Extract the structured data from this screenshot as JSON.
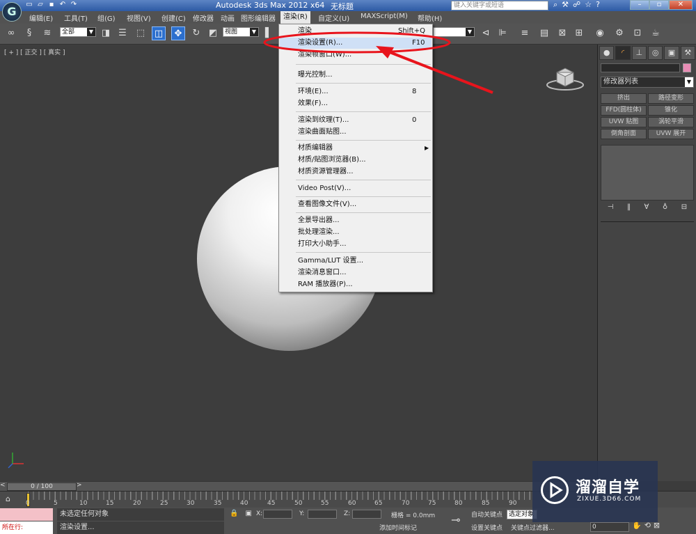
{
  "titlebar": {
    "app_logo": "G",
    "title": "Autodesk 3ds Max  2012 x64",
    "document": "无标题",
    "search_placeholder": "键入关键字或短语",
    "quick_access_icons": [
      "new-file-icon",
      "open-icon",
      "save-icon",
      "undo-icon",
      "redo-icon"
    ],
    "window_controls": [
      "minimize",
      "restore",
      "close"
    ]
  },
  "menubar": {
    "items": [
      "编辑(E)",
      "工具(T)",
      "组(G)",
      "视图(V)",
      "创建(C)",
      "修改器",
      "动画",
      "图形编辑器",
      "渲染(R)",
      "自定义(U)",
      "MAXScript(M)",
      "帮助(H)"
    ],
    "active": "渲染(R)"
  },
  "toolbar": {
    "selection_filter": "全部",
    "reference_coord": "视图"
  },
  "viewport": {
    "label": "[ + ] [ 正交 ] [ 真实 ]"
  },
  "render_menu": {
    "items": [
      {
        "label": "渲染",
        "shortcut": "Shift+Q"
      },
      {
        "label": "渲染设置(R)...",
        "shortcut": "F10"
      },
      {
        "label": "渲染帧窗口(W)...",
        "shortcut": ""
      },
      {
        "label": "曝光控制...",
        "shortcut": ""
      },
      {
        "label": "环境(E)...",
        "shortcut": "8"
      },
      {
        "label": "效果(F)...",
        "shortcut": ""
      },
      {
        "label": "渲染到纹理(T)...",
        "shortcut": "0"
      },
      {
        "label": "渲染曲面贴图...",
        "shortcut": ""
      },
      {
        "label": "材质编辑器",
        "shortcut": ""
      },
      {
        "label": "材质/贴图浏览器(B)...",
        "shortcut": ""
      },
      {
        "label": "材质资源管理器...",
        "shortcut": ""
      },
      {
        "label": "Video Post(V)...",
        "shortcut": ""
      },
      {
        "label": "查看图像文件(V)...",
        "shortcut": ""
      },
      {
        "label": "全景导出器...",
        "shortcut": ""
      },
      {
        "label": "批处理渲染...",
        "shortcut": ""
      },
      {
        "label": "打印大小助手...",
        "shortcut": ""
      },
      {
        "label": "Gamma/LUT 设置...",
        "shortcut": ""
      },
      {
        "label": "渲染消息窗口...",
        "shortcut": ""
      },
      {
        "label": "RAM 播放器(P)...",
        "shortcut": ""
      }
    ],
    "highlighted": "渲染设置(R)..."
  },
  "right_panel": {
    "modifier_list": "修改器列表",
    "modifier_buttons": [
      "挤出",
      "路径变形",
      "FFD(圆柱体)",
      "锥化",
      "UVW 贴图",
      "涡轮平滑",
      "倒角剖面",
      "UVW 展开"
    ],
    "swatch_color": "#e88cb5"
  },
  "timeline": {
    "frame": "0 / 100",
    "tick_labels": [
      "0",
      "5",
      "10",
      "15",
      "20",
      "25",
      "30",
      "35",
      "40",
      "45",
      "50",
      "55",
      "60",
      "65",
      "70",
      "75",
      "80",
      "85",
      "90"
    ]
  },
  "statusbar": {
    "script_label": "所在行:",
    "status": "未选定任何对象",
    "prompt": "渲染设置...",
    "x_label": "X:",
    "y_label": "Y:",
    "z_label": "Z:",
    "grid": "栅格 = 0.0mm",
    "add_time_tag": "添加时间标记",
    "auto_key": "自动关键点",
    "set_key": "设置关键点",
    "selected": "选定对象",
    "key_filter": "关键点过滤器...",
    "frame_value": "0"
  },
  "watermark": {
    "title": "溜溜自学",
    "subtitle": "ZIXUE.3D66.COM"
  }
}
